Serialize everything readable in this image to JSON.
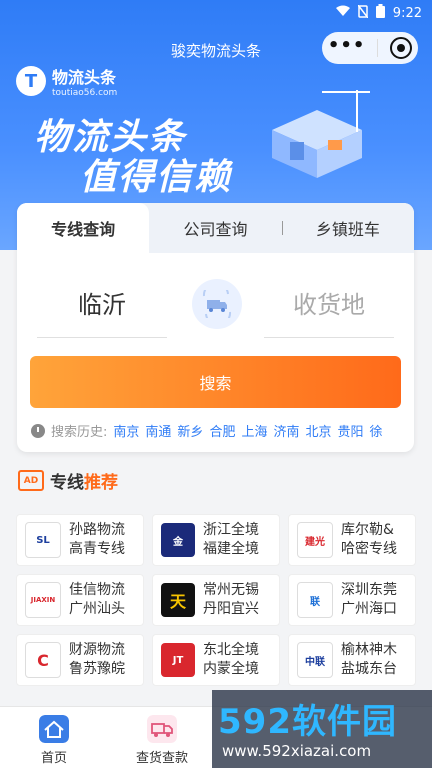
{
  "status_bar": {
    "time": "9:22"
  },
  "header": {
    "title": "骏奕物流头条",
    "capsule_menu": "more-icon",
    "capsule_close": "target-icon"
  },
  "banner": {
    "logo_name": "物流头条",
    "logo_url": "toutiao56.com",
    "slogan_line1": "物流头条",
    "slogan_line2": "值得信赖"
  },
  "search": {
    "tabs": [
      {
        "label": "专线查询",
        "active": true
      },
      {
        "label": "公司查询",
        "active": false
      },
      {
        "label": "乡镇班车",
        "active": false
      }
    ],
    "from_city": "临沂",
    "to_placeholder": "收货地",
    "button_label": "搜索",
    "history_label": "搜索历史:",
    "history": [
      "南京",
      "南通",
      "新乡",
      "合肥",
      "上海",
      "济南",
      "北京",
      "贵阳",
      "徐"
    ]
  },
  "recommend": {
    "icon_text": "AD",
    "title_a": "专线",
    "title_b": "推荐"
  },
  "companies": [
    {
      "line1": "孙路物流",
      "line2": "高青专线",
      "logo_text": "SL",
      "color": "#ffffff"
    },
    {
      "line1": "浙江全境",
      "line2": "福建全境",
      "logo_text": "金",
      "color": "#1b2a7a"
    },
    {
      "line1": "库尔勒&",
      "line2": "哈密专线",
      "logo_text": "建光",
      "color": "#ffffff"
    },
    {
      "line1": "佳信物流",
      "line2": "广州汕头",
      "logo_text": "JIAXIN",
      "color": "#ffffff"
    },
    {
      "line1": "常州无锡",
      "line2": "丹阳宜兴",
      "logo_text": "天",
      "color": "#111111"
    },
    {
      "line1": "深圳东莞",
      "line2": "广州海口",
      "logo_text": "联",
      "color": "#ffffff"
    },
    {
      "line1": "财源物流",
      "line2": "鲁苏豫皖",
      "logo_text": "C",
      "color": "#ffffff"
    },
    {
      "line1": "东北全境",
      "line2": "内蒙全境",
      "logo_text": "JT",
      "color": "#d9272e"
    },
    {
      "line1": "榆林神木",
      "line2": "盐城东台",
      "logo_text": "中联",
      "color": "#ffffff"
    }
  ],
  "tabbar": [
    {
      "label": "首页",
      "icon": "home-icon"
    },
    {
      "label": "查货查款",
      "icon": "truck-icon"
    }
  ],
  "watermark": {
    "big": "592软件园",
    "small": "www.592xiazai.com"
  }
}
